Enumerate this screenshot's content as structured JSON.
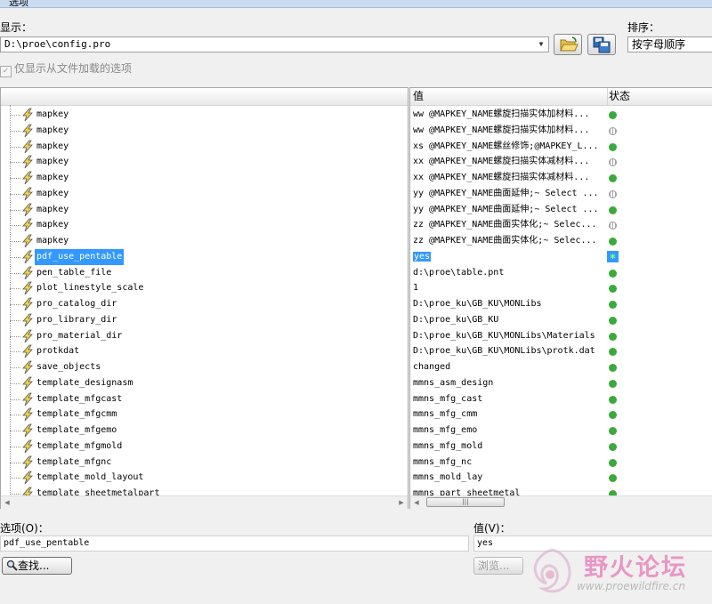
{
  "window": {
    "title": "选项"
  },
  "display": {
    "label": "显示：",
    "file_path": "D:\\proe\\config.pro",
    "open_icon": "folder-open-icon",
    "save_icon": "save-copy-icon"
  },
  "sort": {
    "label": "排序：",
    "value": "按字母顺序"
  },
  "filter_checkbox": {
    "label": "仅显示从文件加载的选项",
    "checked": true
  },
  "columns": {
    "value": "值",
    "status": "状态"
  },
  "rows": [
    {
      "name": "mapkey",
      "value": "ww @MAPKEY_NAME螺旋扫描实体加材料...",
      "status": "on"
    },
    {
      "name": "mapkey",
      "value": "ww @MAPKEY_NAME螺旋扫描实体加材料...",
      "status": "off"
    },
    {
      "name": "mapkey",
      "value": "xs @MAPKEY_NAME螺丝修饰;@MAPKEY_L...",
      "status": "on"
    },
    {
      "name": "mapkey",
      "value": "xx @MAPKEY_NAME螺旋扫描实体减材料...",
      "status": "off"
    },
    {
      "name": "mapkey",
      "value": "xx @MAPKEY_NAME螺旋扫描实体减材料...",
      "status": "on"
    },
    {
      "name": "mapkey",
      "value": "yy @MAPKEY_NAME曲面延伸;~ Select ...",
      "status": "off"
    },
    {
      "name": "mapkey",
      "value": "yy @MAPKEY_NAME曲面延伸;~ Select ...",
      "status": "on"
    },
    {
      "name": "mapkey",
      "value": "zz @MAPKEY_NAME曲面实体化;~ Selec...",
      "status": "off"
    },
    {
      "name": "mapkey",
      "value": "zz @MAPKEY_NAME曲面实体化;~ Selec...",
      "status": "on"
    },
    {
      "name": "pdf_use_pentable",
      "value": "yes",
      "status": "selected",
      "selected": true
    },
    {
      "name": "pen_table_file",
      "value": "d:\\proe\\table.pnt",
      "status": "on"
    },
    {
      "name": "plot_linestyle_scale",
      "value": "1",
      "status": "on"
    },
    {
      "name": "pro_catalog_dir",
      "value": "D:\\proe_ku\\GB_KU\\MONLibs",
      "status": "on"
    },
    {
      "name": "pro_library_dir",
      "value": "D:\\proe_ku\\GB_KU",
      "status": "on"
    },
    {
      "name": "pro_material_dir",
      "value": "D:\\proe_ku\\GB_KU\\MONLibs\\Materials",
      "status": "on"
    },
    {
      "name": "protkdat",
      "value": "D:\\proe_ku\\GB_KU\\MONLibs\\protk.dat",
      "status": "on"
    },
    {
      "name": "save_objects",
      "value": "changed",
      "status": "on"
    },
    {
      "name": "template_designasm",
      "value": "mmns_asm_design",
      "status": "on"
    },
    {
      "name": "template_mfgcast",
      "value": "mmns_mfg_cast",
      "status": "on"
    },
    {
      "name": "template_mfgcmm",
      "value": "mmns_mfg_cmm",
      "status": "on"
    },
    {
      "name": "template_mfgemo",
      "value": "mmns_mfg_emo",
      "status": "on"
    },
    {
      "name": "template_mfgmold",
      "value": "mmns_mfg_mold",
      "status": "on"
    },
    {
      "name": "template_mfgnc",
      "value": "mmns_mfg_nc",
      "status": "on"
    },
    {
      "name": "template_mold_layout",
      "value": "mmns_mold_lay",
      "status": "on"
    },
    {
      "name": "template_sheetmetalpart",
      "value": "mmns_part_sheetmetal",
      "status": "on"
    }
  ],
  "option_field": {
    "label": "选项(O)：",
    "value": "pdf_use_pentable"
  },
  "value_field": {
    "label": "值(V)：",
    "value": "yes"
  },
  "find_button": {
    "label": "查找...",
    "icon": "magnifier-icon"
  },
  "browse_button": {
    "label": "浏览...",
    "disabled": true
  },
  "watermark": {
    "text": "野火论坛",
    "url": "www.proewildfire.cn"
  },
  "colors": {
    "selection": "#3399ff",
    "status_on": "#3aaa3a",
    "watermark": "#e67ab6"
  }
}
